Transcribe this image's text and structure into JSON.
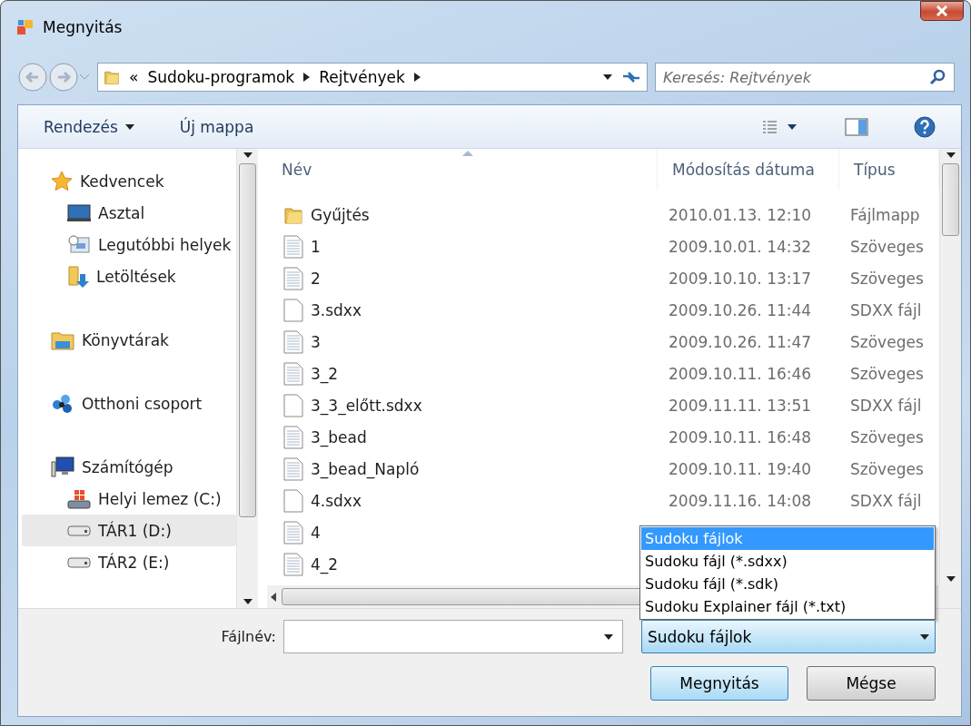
{
  "window": {
    "title": "Megnyitás"
  },
  "address": {
    "overflow": "«",
    "path": [
      {
        "label": "Sudoku-programok"
      },
      {
        "label": "Rejtvények"
      }
    ]
  },
  "search": {
    "placeholder": "Keresés: Rejtvények"
  },
  "toolbar": {
    "organize": "Rendezés",
    "new_folder": "Új mappa"
  },
  "nav": [
    {
      "label": "Kedvencek",
      "kind": "star",
      "selected": false,
      "children": [
        {
          "label": "Asztal",
          "kind": "desktop",
          "selected": false
        },
        {
          "label": "Legutóbbi helyek",
          "kind": "recent",
          "selected": false
        },
        {
          "label": "Letöltések",
          "kind": "download",
          "selected": false
        }
      ]
    },
    {
      "label": "Könyvtárak",
      "kind": "library",
      "selected": false
    },
    {
      "label": "Otthoni csoport",
      "kind": "homegroup",
      "selected": false
    },
    {
      "label": "Számítógép",
      "kind": "computer",
      "selected": false,
      "children": [
        {
          "label": "Helyi lemez (C:)",
          "kind": "sysdrive",
          "selected": false
        },
        {
          "label": "TÁR1 (D:)",
          "kind": "drive",
          "selected": true
        },
        {
          "label": "TÁR2 (E:)",
          "kind": "drive",
          "selected": false
        }
      ]
    }
  ],
  "columns": [
    {
      "label": "Név",
      "sorted": true
    },
    {
      "label": "Módosítás dátuma",
      "sorted": false
    },
    {
      "label": "Típus",
      "sorted": false
    }
  ],
  "files": [
    {
      "name": "Gyűjtés",
      "kind": "folder",
      "date": "2010.01.13. 12:10",
      "type": "Fájlmapp"
    },
    {
      "name": "1",
      "kind": "text",
      "date": "2009.10.01. 14:32",
      "type": "Szöveges"
    },
    {
      "name": "2",
      "kind": "text",
      "date": "2009.10.10. 13:17",
      "type": "Szöveges"
    },
    {
      "name": "3.sdxx",
      "kind": "blank",
      "date": "2009.10.26. 11:44",
      "type": "SDXX fájl"
    },
    {
      "name": "3",
      "kind": "text",
      "date": "2009.10.26. 11:47",
      "type": "Szöveges"
    },
    {
      "name": "3_2",
      "kind": "text",
      "date": "2009.10.11. 16:46",
      "type": "Szöveges"
    },
    {
      "name": "3_3_előtt.sdxx",
      "kind": "blank",
      "date": "2009.11.11. 13:51",
      "type": "SDXX fájl"
    },
    {
      "name": "3_bead",
      "kind": "text",
      "date": "2009.10.11. 16:48",
      "type": "Szöveges"
    },
    {
      "name": "3_bead_Napló",
      "kind": "text",
      "date": "2009.10.11. 19:40",
      "type": "Szöveges"
    },
    {
      "name": "4.sdxx",
      "kind": "blank",
      "date": "2009.11.16. 14:08",
      "type": "SDXX fájl"
    },
    {
      "name": "4",
      "kind": "text"
    },
    {
      "name": "4_2",
      "kind": "text"
    }
  ],
  "filename": {
    "label": "Fájlnév:"
  },
  "filter": {
    "value": "Sudoku fájlok",
    "options": [
      {
        "label": "Sudoku fájlok",
        "selected": true
      },
      {
        "label": "Sudoku fájl (*.sdxx)",
        "selected": false
      },
      {
        "label": "Sudoku fájl (*.sdk)",
        "selected": false
      },
      {
        "label": "Sudoku Explainer fájl (*.txt)",
        "selected": false
      }
    ]
  },
  "buttons": [
    {
      "label": "Megnyitás",
      "default": true
    },
    {
      "label": "Mégse",
      "default": false
    }
  ]
}
